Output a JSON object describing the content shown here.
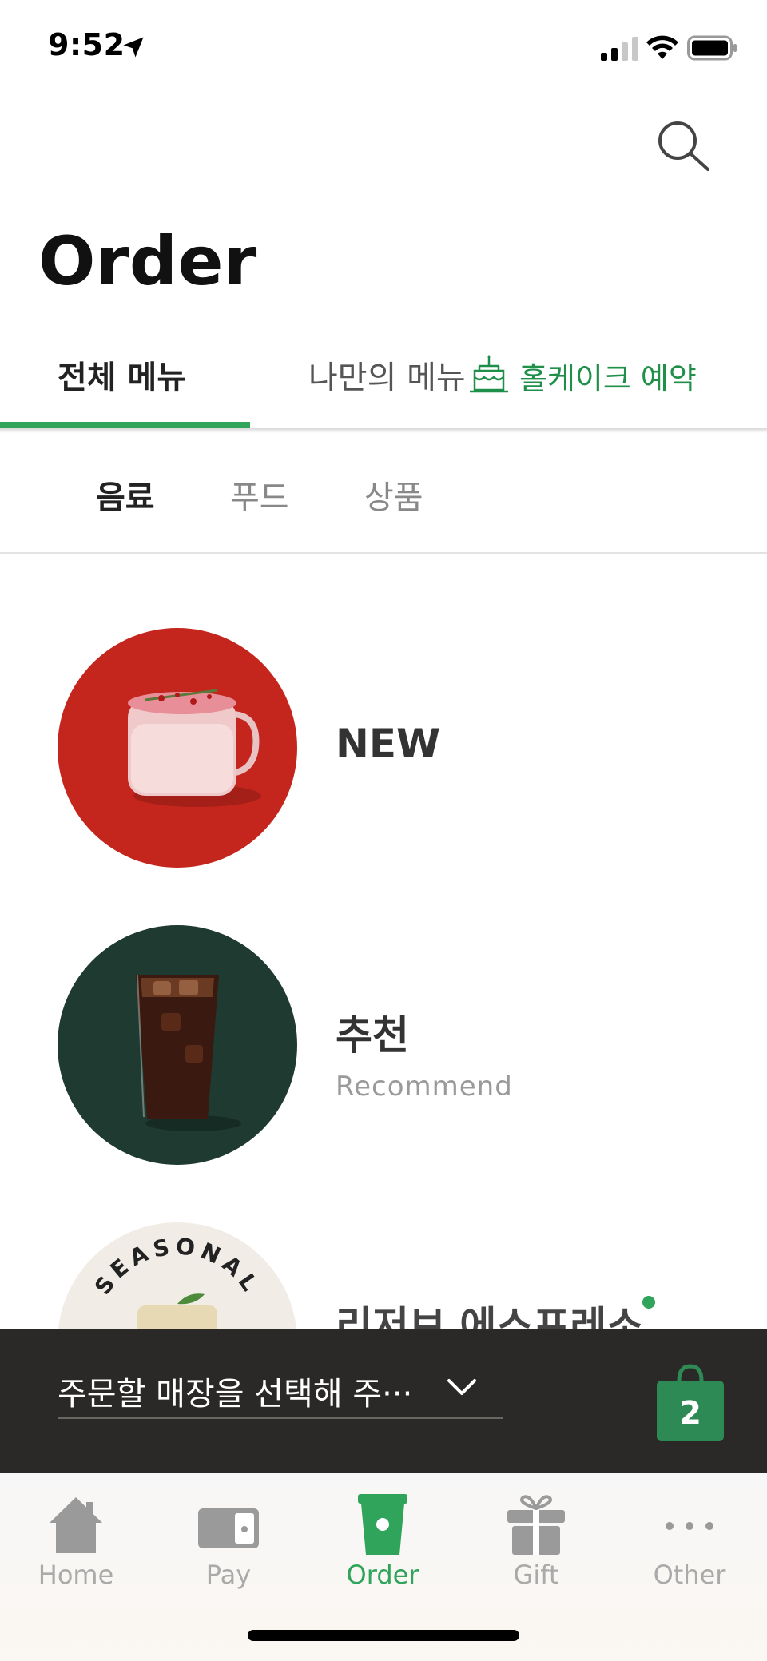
{
  "status": {
    "time": "9:52"
  },
  "header": {
    "title": "Order"
  },
  "tabs": [
    {
      "label": "전체 메뉴"
    },
    {
      "label": "나만의 메뉴"
    },
    {
      "label": "홀케이크 예약"
    }
  ],
  "subtabs": [
    {
      "label": "음료"
    },
    {
      "label": "푸드"
    },
    {
      "label": "상품"
    }
  ],
  "categories": [
    {
      "title": "NEW",
      "subtitle": ""
    },
    {
      "title": "추천",
      "subtitle": "Recommend"
    },
    {
      "title": "리저브 에스프레소",
      "badge_text": "SEASONAL"
    }
  ],
  "store_bar": {
    "placeholder": "주문할 매장을 선택해 주···",
    "cart_count": "2"
  },
  "nav": [
    {
      "label": "Home"
    },
    {
      "label": "Pay"
    },
    {
      "label": "Order"
    },
    {
      "label": "Gift"
    },
    {
      "label": "Other"
    }
  ],
  "colors": {
    "accent": "#2fa45a",
    "store_bar": "#2b2927",
    "new_bg": "#c4261d",
    "recommend_bg": "#1f3a30"
  }
}
